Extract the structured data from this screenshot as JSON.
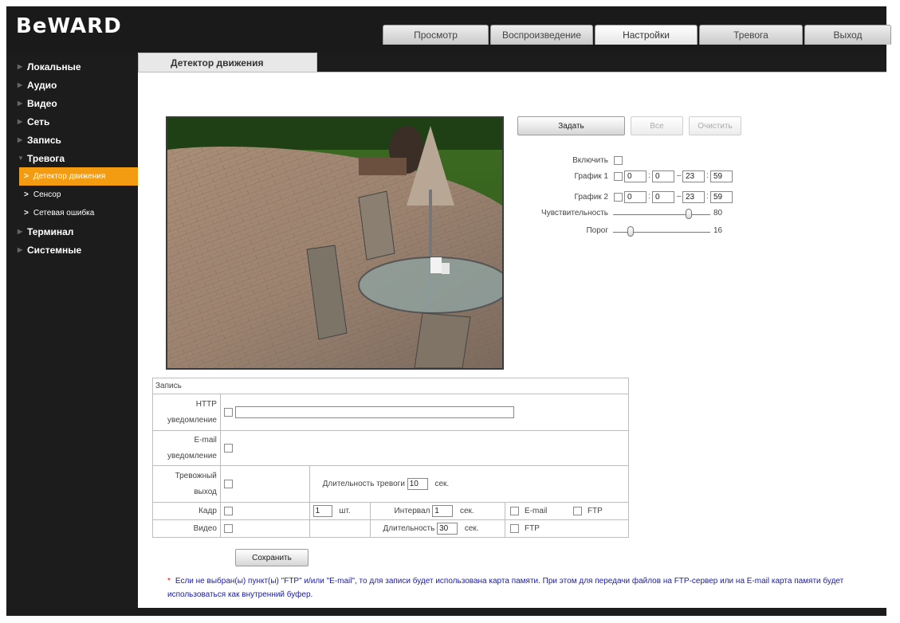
{
  "brand": {
    "logo": "BeWARD"
  },
  "tabs": [
    {
      "label": "Просмотр"
    },
    {
      "label": "Воспроизведение"
    },
    {
      "label": "Настройки"
    },
    {
      "label": "Тревога"
    },
    {
      "label": "Выход"
    }
  ],
  "sidebar": {
    "items": [
      {
        "label": "Локальные"
      },
      {
        "label": "Аудио"
      },
      {
        "label": "Видео"
      },
      {
        "label": "Сеть"
      },
      {
        "label": "Запись"
      },
      {
        "label": "Тревога"
      },
      {
        "label": "Терминал"
      },
      {
        "label": "Системные"
      }
    ],
    "sub": [
      {
        "label": "Детектор движения"
      },
      {
        "label": "Сенсор"
      },
      {
        "label": "Сетевая ошибка"
      }
    ]
  },
  "page": {
    "tab_title": "Детектор движения"
  },
  "controls": {
    "set": "Задать",
    "all": "Все",
    "clear": "Очистить",
    "enable": "Включить",
    "schedule1": "График 1",
    "schedule2": "График 2",
    "s1": {
      "h1": "0",
      "m1": "0",
      "h2": "23",
      "m2": "59"
    },
    "s2": {
      "h1": "0",
      "m1": "0",
      "h2": "23",
      "m2": "59"
    },
    "colon": ":",
    "dash": "–",
    "sensitivity": "Чувствительность",
    "sensitivity_value": "80",
    "sensitivity_level": 80,
    "threshold": "Порог",
    "threshold_value": "16",
    "threshold_level": 16
  },
  "record": {
    "header": "Запись",
    "http_label": "HTTP уведомление",
    "http_url": "",
    "email_label": "E-mail уведомление",
    "alarm_out_label": "Тревожный выход",
    "alarm_duration_label": "Длительность тревоги",
    "alarm_duration": "10",
    "sec": "сек.",
    "frame_label": "Кадр",
    "frame_count": "1",
    "pcs": "шт.",
    "interval_label": "Интервал",
    "interval": "1",
    "email": "E-mail",
    "ftp": "FTP",
    "video_label": "Видео",
    "duration_label": "Длительность",
    "duration": "30"
  },
  "save": "Сохранить",
  "note": "Если не выбран(ы) пункт(ы) \"FTP\" и/или \"E-mail\", то для записи будет использована карта памяти. При этом для передачи файлов на FTP-сервер или на E-mail карта памяти будет использоваться как внутренний буфер.",
  "note_star": "*"
}
